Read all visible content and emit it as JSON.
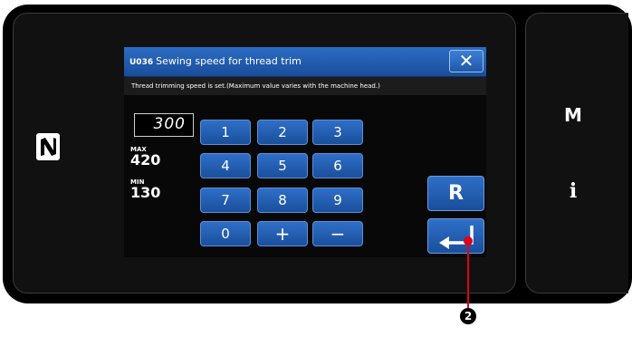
{
  "side_panel": {
    "m_label": "M",
    "info_label": "i"
  },
  "dialog": {
    "code": "U036",
    "title": "Sewing speed for thread trim",
    "close_label": "✕",
    "message": "Thread trimming speed is set.(Maximum value varies with the machine head.)",
    "value": "300",
    "max_label": "MAX",
    "max_value": "420",
    "min_label": "MIN",
    "min_value": "130"
  },
  "keypad": {
    "k1": "1",
    "k2": "2",
    "k3": "3",
    "k4": "4",
    "k5": "5",
    "k6": "6",
    "k7": "7",
    "k8": "8",
    "k9": "9",
    "k0": "0",
    "plus": "+",
    "minus": "−",
    "reset": "R"
  },
  "callout": {
    "number": "2"
  }
}
